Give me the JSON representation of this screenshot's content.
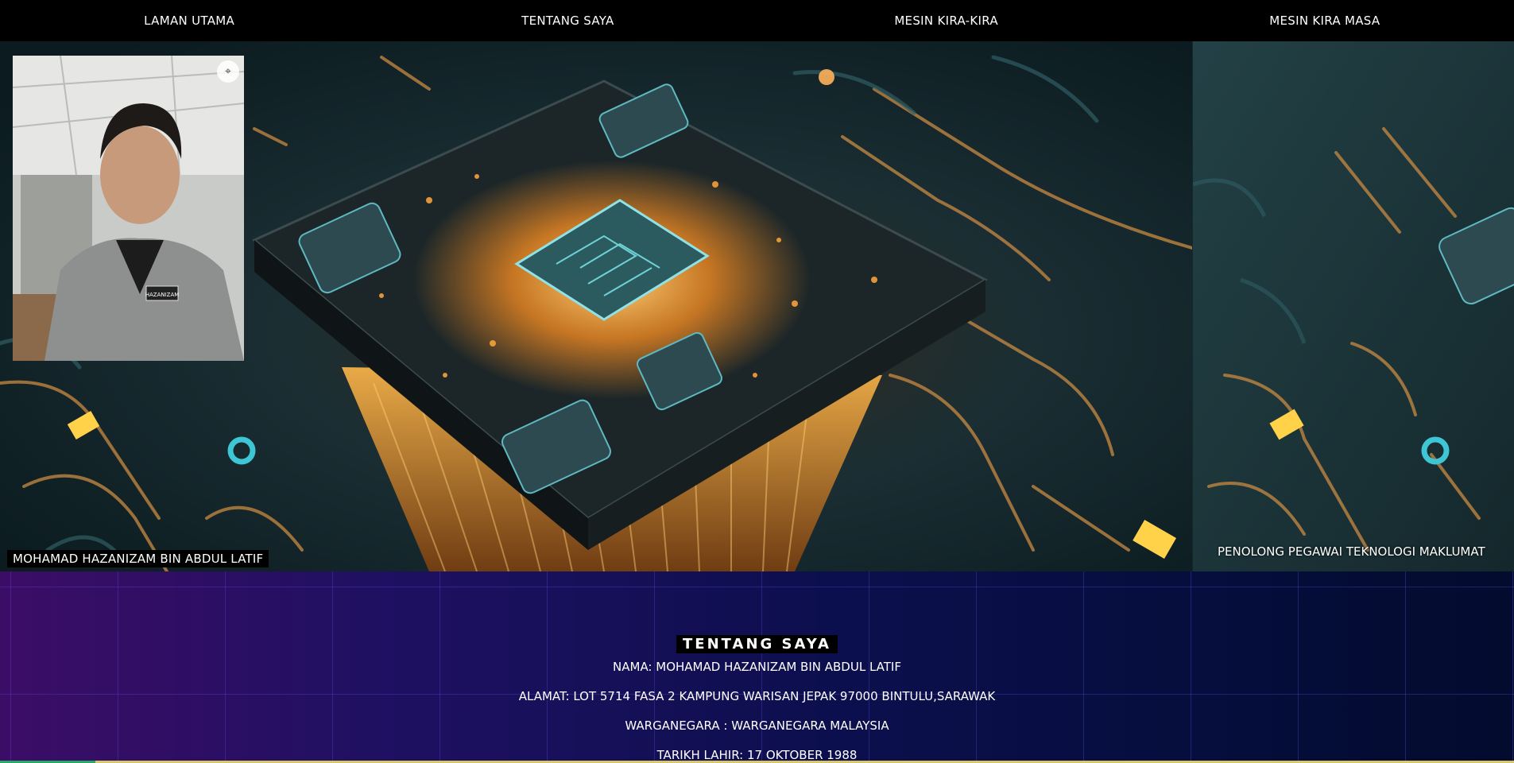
{
  "nav": {
    "items": [
      "LAMAN UTAMA",
      "TENTANG SAYA",
      "MESIN KIRA-KIRA",
      "MESIN KIRA MASA"
    ]
  },
  "hero": {
    "name_caption": "MOHAMAD HAZANIZAM BIN ABDUL LATIF",
    "job_caption": "PENOLONG PEGAWAI TEKNOLOGI MAKLUMAT",
    "photo_badge": "HAZANIZAM"
  },
  "about": {
    "title": "TENTANG SAYA",
    "nama": "NAMA: MOHAMAD HAZANIZAM BIN ABDUL LATIF",
    "alamat": "ALAMAT: LOT 5714 FASA 2 KAMPUNG WARISAN JEPAK 97000 BINTULU,SARAWAK",
    "warganegara": "WARGANEGARA : WARGANEGARA MALAYSIA",
    "tarikh_lahir": "TARIKH LAHIR: 17 OKTOBER 1988"
  },
  "colors": {
    "nav_bg": "#000000",
    "chip_glow": "#f5a53a",
    "circuit_teal": "#1d3a40",
    "about_left": "#3c0d66",
    "about_right": "#030b2e"
  }
}
